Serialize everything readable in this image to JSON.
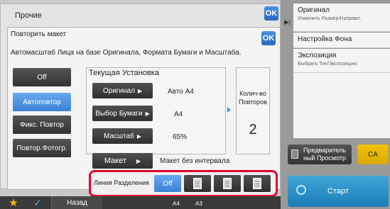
{
  "outer_dialog": {
    "title": "Прочие",
    "ok_label": "OK"
  },
  "inner_dialog": {
    "title": "Повторить макет",
    "ok_label": "OK",
    "description": "Автомасштаб Лица на базе Оригинала, Формата Бумаги и Масштаба."
  },
  "mode_buttons": [
    {
      "label": "Off",
      "selected": false
    },
    {
      "label": "Автоповтор",
      "selected": true
    },
    {
      "label": "Фикс. Повтор",
      "selected": false
    },
    {
      "label": "Повтор.Фотогр.",
      "selected": false
    }
  ],
  "current_settings": {
    "title": "Текущая Установка",
    "original": {
      "label": "Оригинал",
      "value": "Авто  A4"
    },
    "paper": {
      "label": "Выбор Бумаги",
      "value": "A4"
    },
    "scale": {
      "label": "Масштаб",
      "value": "65%"
    }
  },
  "repeat_count": {
    "label": "Колич-во Повторов",
    "value": "2"
  },
  "layout": {
    "label": "Макет",
    "value": "Макет без интервала"
  },
  "separator": {
    "label": "Линия Разделения",
    "off_label": "Off",
    "options": [
      "separator-single-page-icon",
      "separator-double-page-icon",
      "separator-corner-page-icon"
    ]
  },
  "right_panel": {
    "original": {
      "title": "Оригинал",
      "subtitle": "Изменить Размер/Направл."
    },
    "background": {
      "title": "Настройка Фона"
    },
    "exposure": {
      "title": "Экспозиция",
      "subtitle": "Выбрать Тип/Экспозицию"
    }
  },
  "preview_label": "Предваритель ный Просмотр",
  "ca_label": "CA",
  "start_label": "Старт",
  "bottom_bar": {
    "back_label": "Назад",
    "page_label": "A4",
    "paper_label": "A3"
  },
  "colors": {
    "accent": "#3c7fd6",
    "highlight": "#e00030",
    "ca": "#f2c400",
    "start": "#1c7cb6"
  }
}
